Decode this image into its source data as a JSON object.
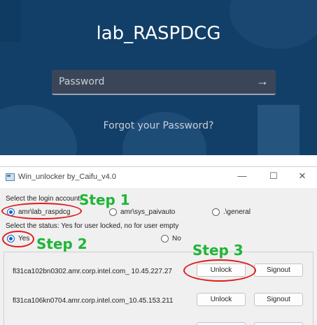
{
  "login": {
    "title": "lab_RASPDCG",
    "password_placeholder": "Password",
    "submit_glyph": "→",
    "forgot_link": "Forgot your Password?"
  },
  "window": {
    "title": "Win_unlocker by_Caifu_v4.0",
    "controls": {
      "minimize": "—",
      "maximize": "☐",
      "close": "✕"
    }
  },
  "accounts": {
    "label": "Select the login account:",
    "options": [
      "amr\\lab_raspdcg",
      "amr\\sys_paivauto",
      ".\\general"
    ],
    "selected": "amr\\lab_raspdcg"
  },
  "status": {
    "label": "Select the status: Yes for user locked, no for user empty",
    "options": [
      "Yes",
      "No"
    ],
    "selected": "Yes"
  },
  "steps": [
    "Step 1",
    "Step 2",
    "Step 3"
  ],
  "hosts": [
    {
      "name": "fl31ca102bn0302.amr.corp.intel.com_ 10.45.227.27",
      "unlock": "Unlock",
      "signout": "Signout"
    },
    {
      "name": "fl31ca106kn0704.amr.corp.intel.com_10.45.153.211",
      "unlock": "Unlock",
      "signout": "Signout"
    }
  ],
  "colors": {
    "step": "#1fb535",
    "annotation": "#e01b1b",
    "login_bg": "#123f68",
    "radio_selected": "#0a64c8"
  },
  "icons": [
    "arrow-right-icon",
    "app-window-icon"
  ]
}
